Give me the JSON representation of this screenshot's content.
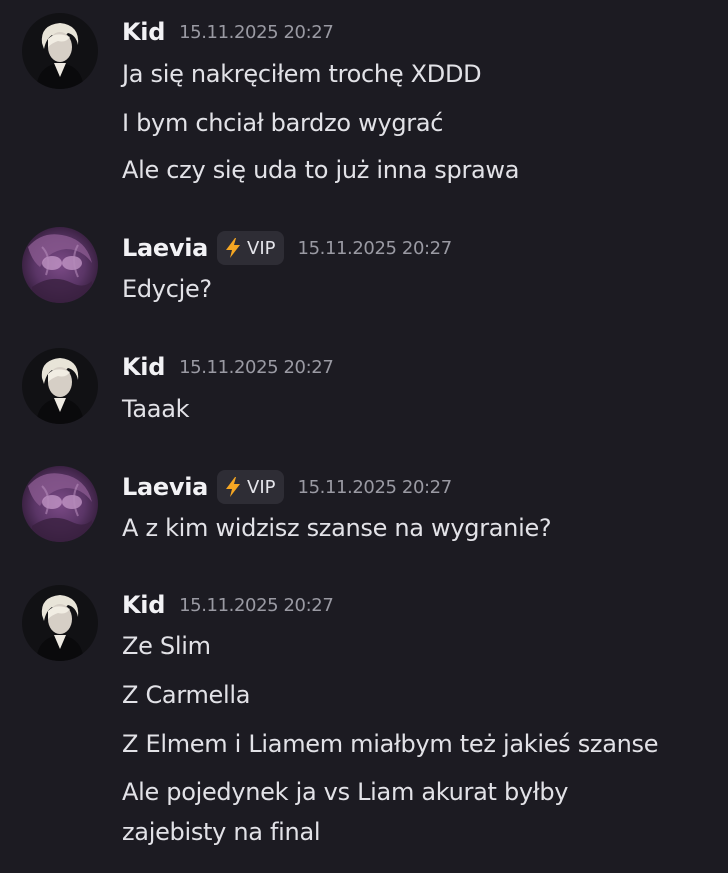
{
  "colors": {
    "background": "#1c1b22",
    "username": "#f2f2f5",
    "timestamp": "#9a9aa3",
    "badge_bg": "#2e2d35",
    "bolt": "#f5a623"
  },
  "messages": [
    {
      "author": "Kid",
      "avatar_icon": "kid-avatar",
      "timestamp": "15.11.2025 20:27",
      "lines": [
        "Ja się nakręciłem trochę XDDD",
        "I bym chciał bardzo wygrać",
        "Ale czy się uda to już inna sprawa"
      ]
    },
    {
      "author": "Laevia",
      "avatar_icon": "laevia-avatar",
      "badge": {
        "icon": "lightning-bolt-icon",
        "label": "VIP"
      },
      "timestamp": "15.11.2025 20:27",
      "lines": [
        "Edycje?"
      ]
    },
    {
      "author": "Kid",
      "avatar_icon": "kid-avatar",
      "timestamp": "15.11.2025 20:27",
      "lines": [
        "Taaak"
      ]
    },
    {
      "author": "Laevia",
      "avatar_icon": "laevia-avatar",
      "badge": {
        "icon": "lightning-bolt-icon",
        "label": "VIP"
      },
      "timestamp": "15.11.2025 20:27",
      "lines": [
        "A z kim widzisz szanse na wygranie?"
      ]
    },
    {
      "author": "Kid",
      "avatar_icon": "kid-avatar",
      "timestamp": "15.11.2025 20:27",
      "lines": [
        "Ze Slim",
        "Z Carmella",
        "Z Elmem i Liamem miałbym też jakieś szanse",
        "Ale pojedynek ja vs Liam akurat byłby",
        "zajebisty na final"
      ]
    }
  ]
}
